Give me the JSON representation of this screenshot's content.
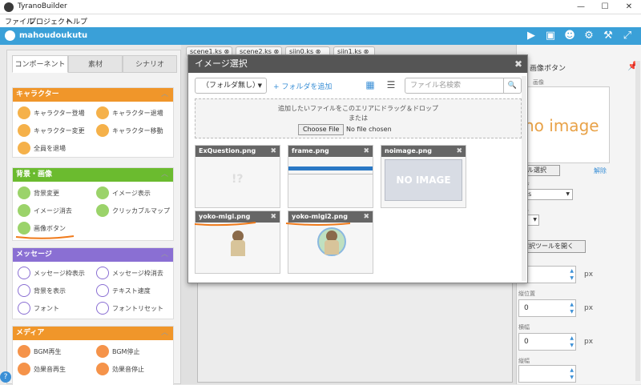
{
  "window": {
    "title": "TyranoBuilder",
    "minimize": "—",
    "maximize": "☐",
    "close": "✕"
  },
  "menu": [
    "ファイル",
    "プロジェクト",
    "ヘルプ"
  ],
  "project": {
    "name": "mahoudoukutu"
  },
  "toolbar_icons": [
    "play-icon",
    "save-icon",
    "users-icon",
    "gear-icon",
    "hammer-icon",
    "fullscreen-icon"
  ],
  "left_tabs": [
    "コンポーネント",
    "素材",
    "シナリオ"
  ],
  "sections": [
    {
      "title": "キャラクター",
      "color": "#f0962a",
      "items": [
        "キャラクター登場",
        "キャラクター退場",
        "キャラクター変更",
        "キャラクター移動",
        "全員を退場"
      ]
    },
    {
      "title": "背景・画像",
      "color": "#6bbb2f",
      "items": [
        "背景変更",
        "イメージ表示",
        "イメージ消去",
        "クリッカブルマップ",
        "画像ボタン"
      ]
    },
    {
      "title": "メッセージ",
      "color": "#8a6fd3",
      "items": [
        "メッセージ枠表示",
        "メッセージ枠消去",
        "背景を表示",
        "テキスト速度",
        "フォント",
        "フォントリセット"
      ]
    },
    {
      "title": "メディア",
      "color": "#f0962a",
      "items": [
        "BGM再生",
        "BGM停止",
        "効果音再生",
        "効果音停止"
      ]
    }
  ],
  "file_tabs": [
    "scene1.ks",
    "scene2.ks",
    "siin0.ks",
    "siin1.ks"
  ],
  "modal": {
    "title": "イメージ選択",
    "folder_select": "（フォルダ無し）",
    "add_folder": "+ フォルダを追加",
    "search_placeholder": "ファイル名検索",
    "drop_text": "追加したいファイルをこのエリアにドラッグ＆ドロップ",
    "or_text": "または",
    "choose_file": "Choose File",
    "no_file": "No file chosen",
    "files": [
      "ExQuestion.png",
      "frame.png",
      "noimage.png",
      "yoko-migi.png",
      "yoko-migi2.png"
    ],
    "noimage_text": "NO IMAGE"
  },
  "right_panel": {
    "title": "画像ボタン",
    "image_label": "画像",
    "no_image_text": "no image",
    "file_select": "イル選択",
    "remove": "解除",
    "storage_label": "ージ",
    "storage_value": ".ks",
    "target_label": "ット",
    "select_tool_label": "択",
    "select_tool_button": "選択ツールを開く",
    "num_fields": [
      {
        "label": "",
        "value": "",
        "unit": "px"
      },
      {
        "label": "縦位置",
        "value": "0",
        "unit": "px"
      },
      {
        "label": "横幅",
        "value": "0",
        "unit": "px"
      },
      {
        "label": "縦幅",
        "value": "",
        "unit": ""
      }
    ]
  },
  "accent": "#3aa0d8",
  "annotation_color": "#f07a1a"
}
